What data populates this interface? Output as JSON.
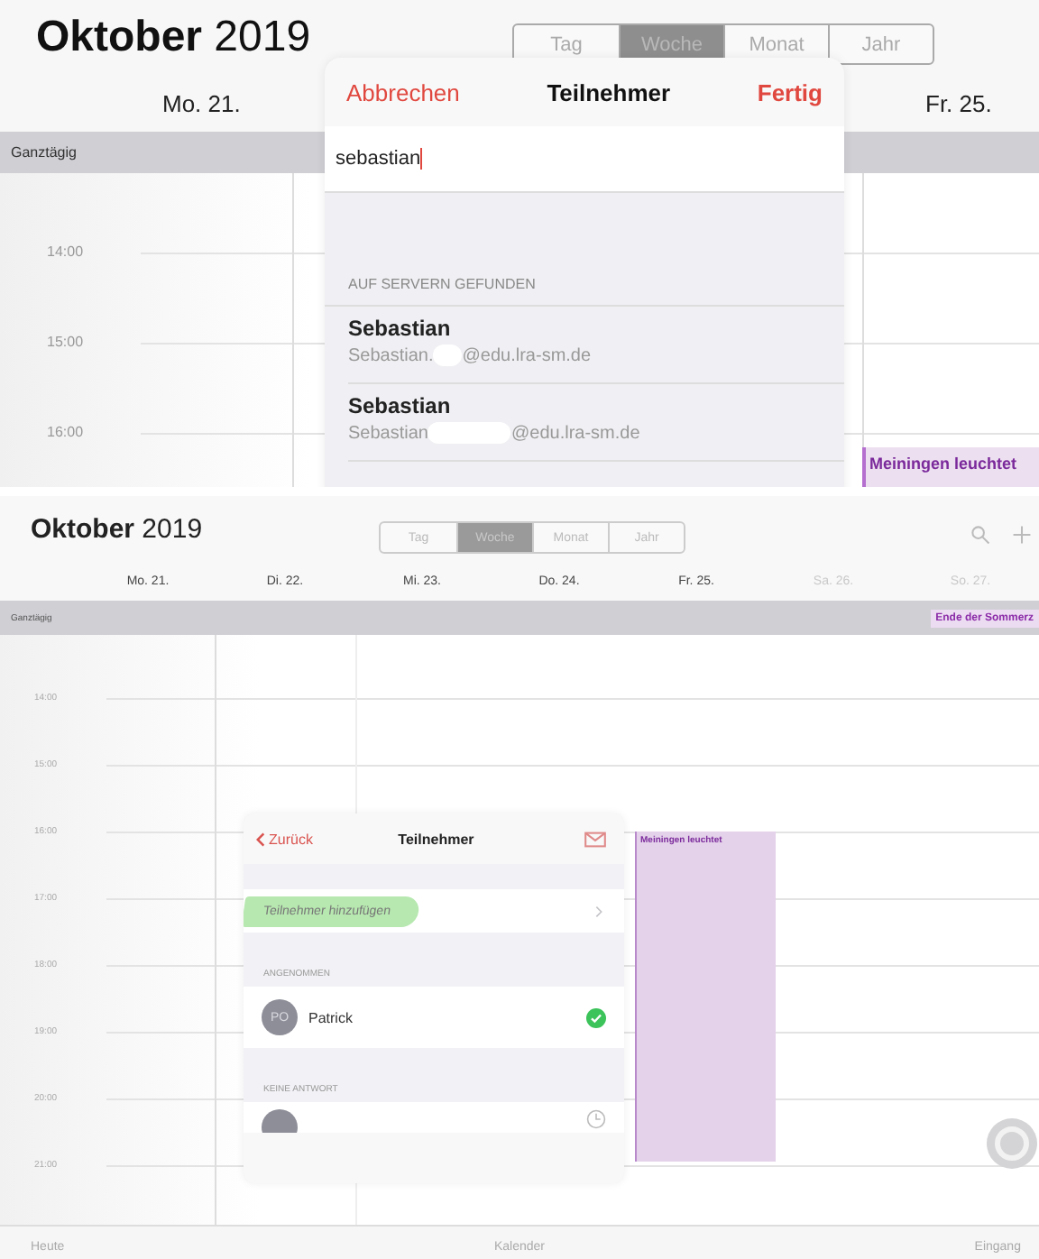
{
  "top_view": {
    "title": {
      "month": "Oktober",
      "year": "2019"
    },
    "view_modes": [
      {
        "label": "Tag",
        "selected": false
      },
      {
        "label": "Woche",
        "selected": true
      },
      {
        "label": "Monat",
        "selected": false
      },
      {
        "label": "Jahr",
        "selected": false
      }
    ],
    "day_headers": [
      "Mo. 21.",
      "Fr. 25."
    ],
    "allday_label": "Ganztägig",
    "hours": [
      "14:00",
      "15:00",
      "16:00"
    ],
    "event": {
      "title": "Meiningen leuchtet"
    },
    "popover": {
      "cancel": "Abbrechen",
      "title": "Teilnehmer",
      "done": "Fertig",
      "search_value": "sebastian",
      "section": "AUF SERVERN GEFUNDEN",
      "results": [
        {
          "name": "Sebastian",
          "email_start": "Sebastian.",
          "email_end": "@edu.lra-sm.de"
        },
        {
          "name": "Sebastian",
          "email_start": "Sebastian",
          "email_end": "@edu.lra-sm.de"
        }
      ]
    }
  },
  "bottom_view": {
    "title": {
      "month": "Oktober",
      "year": "2019"
    },
    "view_modes": [
      {
        "label": "Tag",
        "selected": false
      },
      {
        "label": "Woche",
        "selected": true
      },
      {
        "label": "Monat",
        "selected": false
      },
      {
        "label": "Jahr",
        "selected": false
      }
    ],
    "day_headers": [
      {
        "label": "Mo. 21.",
        "weekend": false
      },
      {
        "label": "Di. 22.",
        "weekend": false
      },
      {
        "label": "Mi. 23.",
        "weekend": false
      },
      {
        "label": "Do. 24.",
        "weekend": false
      },
      {
        "label": "Fr. 25.",
        "weekend": false
      },
      {
        "label": "Sa. 26.",
        "weekend": true
      },
      {
        "label": "So. 27.",
        "weekend": true
      }
    ],
    "allday_label": "Ganztägig",
    "allday_event": "Ende der Sommerz",
    "hours": [
      "14:00",
      "15:00",
      "16:00",
      "17:00",
      "18:00",
      "19:00",
      "20:00",
      "21:00"
    ],
    "event": {
      "title": "Meiningen leuchtet"
    },
    "popover": {
      "back": "Zurück",
      "title": "Teilnehmer",
      "add_row": {
        "label": "Teilnehmer hinzufügen",
        "highlighted": true
      },
      "sections": [
        {
          "header": "ANGENOMMEN",
          "people": [
            {
              "initials": "PO",
              "name": "Patrick",
              "kind": "accepted"
            }
          ]
        },
        {
          "header": "KEINE ANTWORT",
          "people": [
            {
              "kind": "pending"
            }
          ]
        }
      ]
    },
    "tab_bar": [
      "Heute",
      "Kalender",
      "Eingang"
    ]
  }
}
